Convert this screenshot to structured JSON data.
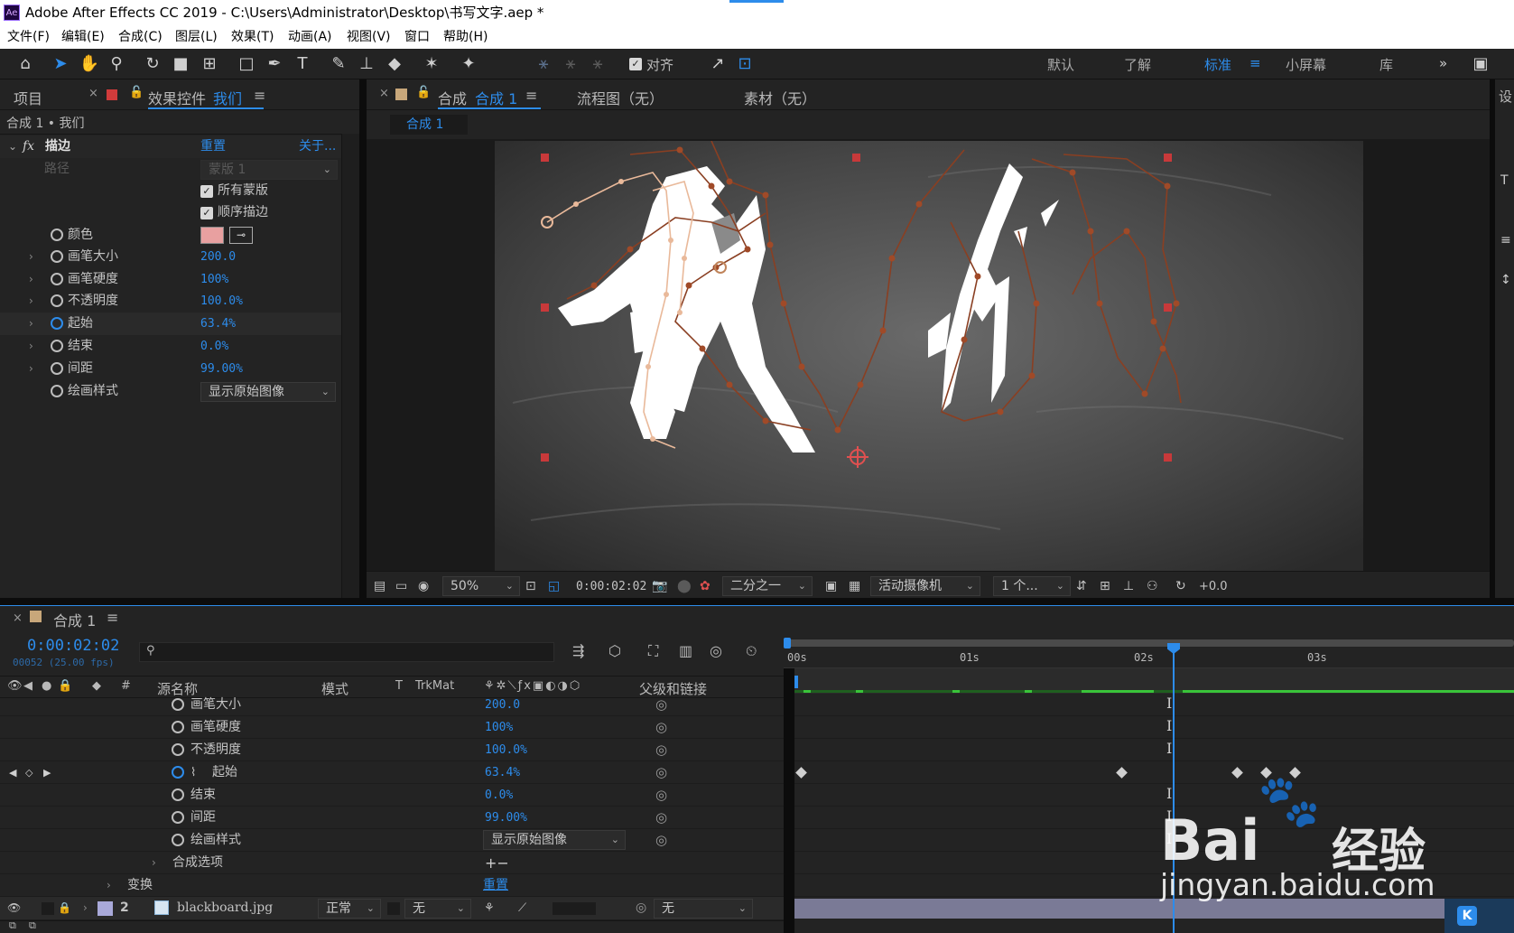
{
  "window": {
    "title": "Adobe After Effects CC 2019 - C:\\Users\\Administrator\\Desktop\\书写文字.aep *",
    "logo": "Ae"
  },
  "menu": [
    "文件(F)",
    "编辑(E)",
    "合成(C)",
    "图层(L)",
    "效果(T)",
    "动画(A)",
    "视图(V)",
    "窗口",
    "帮助(H)"
  ],
  "toolbar": {
    "snap_label": "对齐",
    "workspaces": [
      "默认",
      "了解",
      "标准",
      "小屏幕",
      "库"
    ],
    "active_workspace": "标准",
    "more": "»"
  },
  "left_panel": {
    "tab_project": "项目",
    "tab_effects_prefix": "效果控件",
    "tab_effects_layer": "我们",
    "breadcrumb": "合成 1 • 我们",
    "effect_name": "描边",
    "fx_badge": "fx",
    "reset": "重置",
    "about": "关于...",
    "path_label": "路径",
    "path_value": "蒙版 1",
    "all_masks": "所有蒙版",
    "stroke_sequentially": "顺序描边",
    "color_label": "颜色",
    "color_value": "#e8a0a0",
    "props": [
      {
        "label": "画笔大小",
        "value": "200.0"
      },
      {
        "label": "画笔硬度",
        "value": "100%"
      },
      {
        "label": "不透明度",
        "value": "100.0%"
      },
      {
        "label": "起始",
        "value": "63.4%"
      },
      {
        "label": "结束",
        "value": "0.0%"
      },
      {
        "label": "间距",
        "value": "99.00%"
      }
    ],
    "paint_style_label": "绘画样式",
    "paint_style_value": "显示原始图像"
  },
  "viewer": {
    "tab_comp_prefix": "合成",
    "tab_comp_name": "合成 1",
    "tab_flowchart": "流程图（无）",
    "tab_footage": "素材（无）",
    "subtab": "合成 1",
    "zoom": "50%",
    "timecode": "0:00:02:02",
    "resolution": "二分之一",
    "camera": "活动摄像机",
    "views": "1 个...",
    "exposure": "+0.0"
  },
  "right_panel": {
    "label": "设"
  },
  "timeline": {
    "tab": "合成 1",
    "timecode": "0:00:02:02",
    "frame_info": "00052 (25.00 fps)",
    "search_placeholder": "",
    "headers": {
      "hash": "#",
      "source": "源名称",
      "mode": "模式",
      "t": "T",
      "trkmat": "TrkMat",
      "parent": "父级和链接"
    },
    "rows": [
      {
        "label": "画笔大小",
        "value": "200.0"
      },
      {
        "label": "画笔硬度",
        "value": "100%"
      },
      {
        "label": "不透明度",
        "value": "100.0%"
      },
      {
        "label": "起始",
        "value": "63.4%"
      },
      {
        "label": "结束",
        "value": "0.0%"
      },
      {
        "label": "间距",
        "value": "99.00%"
      }
    ],
    "paint_style_label": "绘画样式",
    "paint_style_value": "显示原始图像",
    "comp_options": "合成选项",
    "comp_options_ops": "+−",
    "transform": "变换",
    "transform_reset": "重置",
    "layer": {
      "index": "2",
      "name": "blackboard.jpg",
      "mode": "正常",
      "trkmat": "无",
      "parent": "无"
    },
    "ruler": [
      "00s",
      "01s",
      "02s",
      "03s"
    ]
  },
  "watermark": {
    "brand": "Bai",
    "brand2": "经验",
    "url": "jingyan.baidu.com"
  }
}
